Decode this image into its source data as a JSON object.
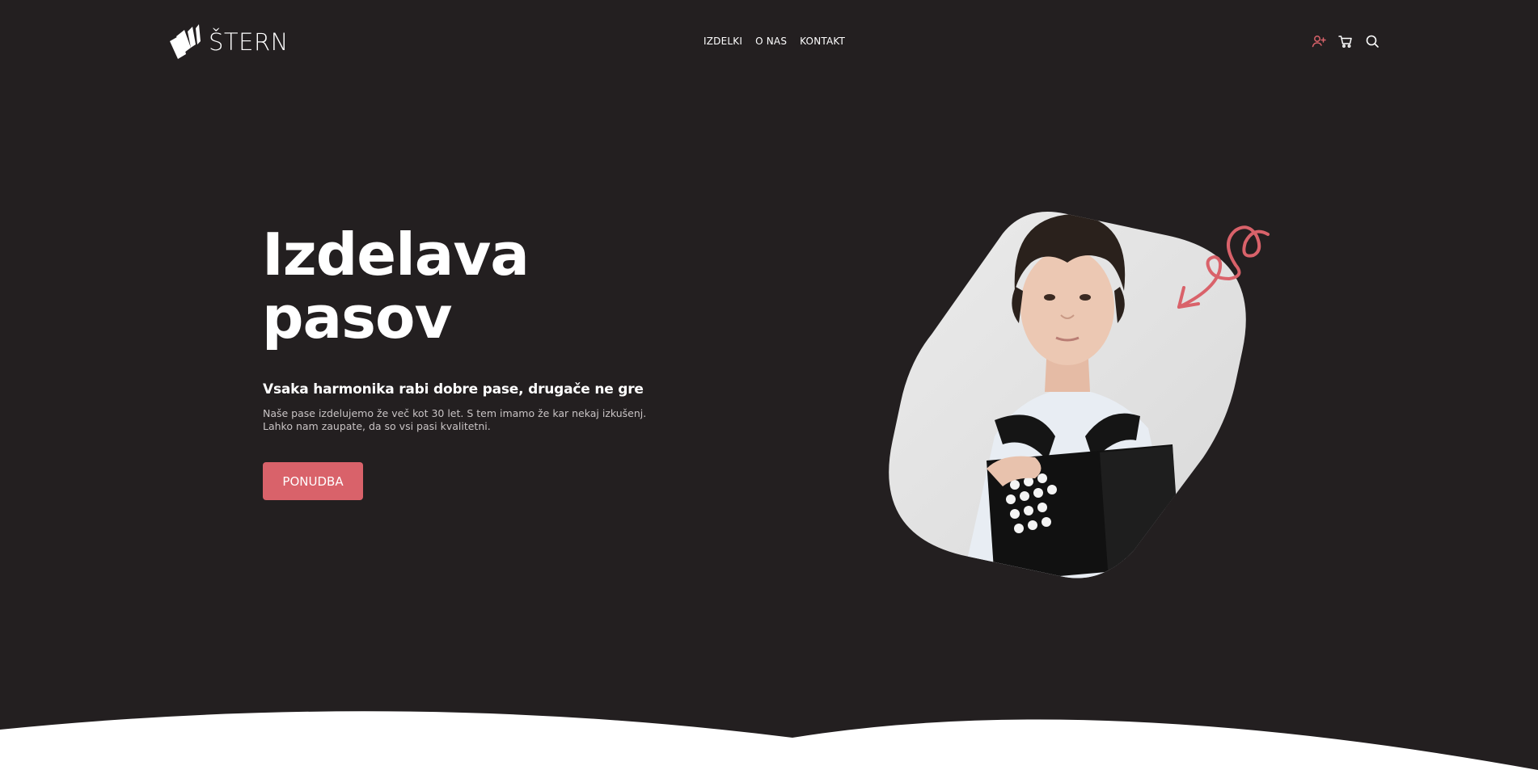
{
  "header": {
    "logo_text": "ŠTERN",
    "nav": [
      {
        "label": "IZDELKI"
      },
      {
        "label": "O NAS"
      },
      {
        "label": "KONTAKT"
      }
    ],
    "icons": [
      "user-plus-icon",
      "cart-icon",
      "search-icon"
    ]
  },
  "hero": {
    "title_line1": "Izdelava",
    "title_line2": "pasov",
    "subtitle": "Vsaka harmonika rabi dobre pase, drugače ne gre",
    "description": "Naše pase izdelujemo že več kot 30 let. S tem imamo že kar nekaj izkušenj. Lahko nam zaupate, da so vsi pasi kvalitetni.",
    "cta_label": "PONUDBA"
  },
  "colors": {
    "background": "#231f20",
    "accent": "#d9626a",
    "text": "#ffffff",
    "muted_text": "#c9c4c5",
    "wave": "#ffffff"
  }
}
